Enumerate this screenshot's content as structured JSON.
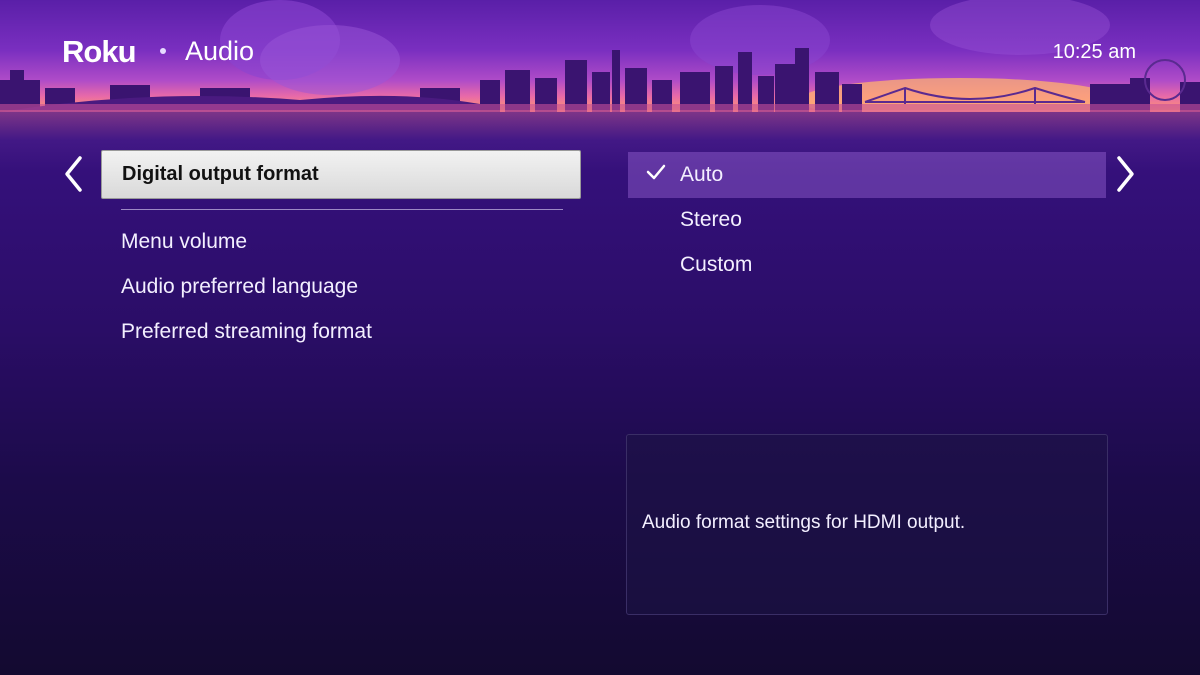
{
  "header": {
    "logo": "Roku",
    "title": "Audio",
    "time": "10:25 am"
  },
  "menu": {
    "selected": "Digital output format",
    "items": [
      "Menu volume",
      "Audio preferred language",
      "Preferred streaming format"
    ]
  },
  "options": {
    "selected": "Auto",
    "items": [
      "Stereo",
      "Custom"
    ]
  },
  "info": {
    "text": "Audio format settings for HDMI output."
  },
  "icons": {
    "back": "chevron-left-icon",
    "forward": "chevron-right-icon",
    "check": "checkmark-icon"
  },
  "colors": {
    "background_top": "#4a1a8c",
    "background_bottom": "#130a30",
    "selected_menu_bg": "#e6e6e6",
    "selected_option_bg": "#7a52b4"
  }
}
